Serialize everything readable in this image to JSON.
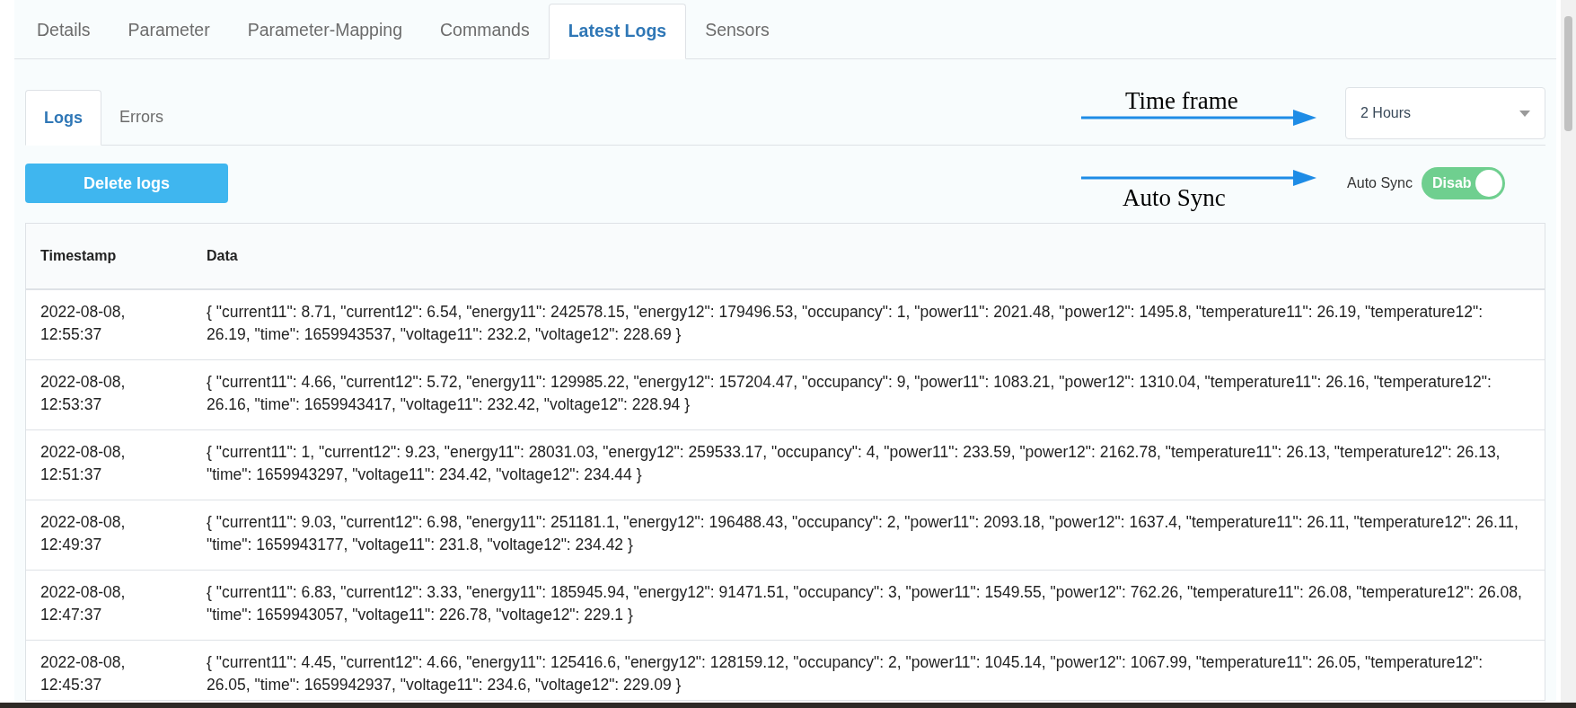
{
  "tabs": [
    {
      "label": "Details",
      "selected": false
    },
    {
      "label": "Parameter",
      "selected": false
    },
    {
      "label": "Parameter-Mapping",
      "selected": false
    },
    {
      "label": "Commands",
      "selected": false
    },
    {
      "label": "Latest Logs",
      "selected": true
    },
    {
      "label": "Sensors",
      "selected": false
    }
  ],
  "subtabs": [
    {
      "label": "Logs",
      "selected": true
    },
    {
      "label": "Errors",
      "selected": false
    }
  ],
  "delete_button": "Delete logs",
  "time_frame": {
    "value": "2 Hours"
  },
  "auto_sync": {
    "label": "Auto Sync",
    "toggle_text": "Disab",
    "on": true
  },
  "annotations": [
    {
      "text": "Time frame",
      "kind": "above"
    },
    {
      "text": "Auto Sync",
      "kind": "below"
    }
  ],
  "table": {
    "columns": [
      "Timestamp",
      "Data"
    ],
    "rows": [
      {
        "timestamp": "2022-08-08, 12:55:37",
        "data": "{ \"current11\": 8.71, \"current12\": 6.54, \"energy11\": 242578.15, \"energy12\": 179496.53, \"occupancy\": 1, \"power11\": 2021.48, \"power12\": 1495.8, \"temperature11\": 26.19, \"temperature12\": 26.19, \"time\": 1659943537, \"voltage11\": 232.2, \"voltage12\": 228.69 }"
      },
      {
        "timestamp": "2022-08-08, 12:53:37",
        "data": "{ \"current11\": 4.66, \"current12\": 5.72, \"energy11\": 129985.22, \"energy12\": 157204.47, \"occupancy\": 9, \"power11\": 1083.21, \"power12\": 1310.04, \"temperature11\": 26.16, \"temperature12\": 26.16, \"time\": 1659943417, \"voltage11\": 232.42, \"voltage12\": 228.94 }"
      },
      {
        "timestamp": "2022-08-08, 12:51:37",
        "data": "{ \"current11\": 1, \"current12\": 9.23, \"energy11\": 28031.03, \"energy12\": 259533.17, \"occupancy\": 4, \"power11\": 233.59, \"power12\": 2162.78, \"temperature11\": 26.13, \"temperature12\": 26.13, \"time\": 1659943297, \"voltage11\": 234.42, \"voltage12\": 234.44 }"
      },
      {
        "timestamp": "2022-08-08, 12:49:37",
        "data": "{ \"current11\": 9.03, \"current12\": 6.98, \"energy11\": 251181.1, \"energy12\": 196488.43, \"occupancy\": 2, \"power11\": 2093.18, \"power12\": 1637.4, \"temperature11\": 26.11, \"temperature12\": 26.11, \"time\": 1659943177, \"voltage11\": 231.8, \"voltage12\": 234.42 }"
      },
      {
        "timestamp": "2022-08-08, 12:47:37",
        "data": "{ \"current11\": 6.83, \"current12\": 3.33, \"energy11\": 185945.94, \"energy12\": 91471.51, \"occupancy\": 3, \"power11\": 1549.55, \"power12\": 762.26, \"temperature11\": 26.08, \"temperature12\": 26.08, \"time\": 1659943057, \"voltage11\": 226.78, \"voltage12\": 229.1 }"
      },
      {
        "timestamp": "2022-08-08, 12:45:37",
        "data": "{ \"current11\": 4.45, \"current12\": 4.66, \"energy11\": 125416.6, \"energy12\": 128159.12, \"occupancy\": 2, \"power11\": 1045.14, \"power12\": 1067.99, \"temperature11\": 26.05, \"temperature12\": 26.05, \"time\": 1659942937, \"voltage11\": 234.6, \"voltage12\": 229.09 }"
      }
    ]
  }
}
